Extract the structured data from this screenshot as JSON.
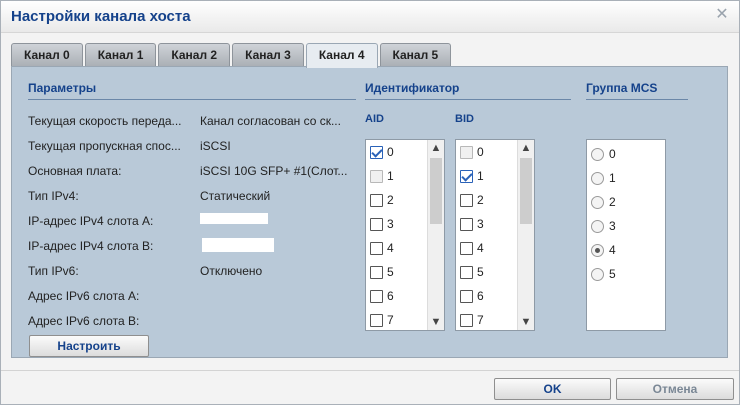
{
  "dialog": {
    "title": "Настройки канала хоста"
  },
  "tabs": [
    {
      "label": "Канал 0",
      "active": false
    },
    {
      "label": "Канал 1",
      "active": false
    },
    {
      "label": "Канал 2",
      "active": false
    },
    {
      "label": "Канал 3",
      "active": false
    },
    {
      "label": "Канал 4",
      "active": true
    },
    {
      "label": "Канал 5",
      "active": false
    }
  ],
  "params": {
    "title": "Параметры",
    "rows": [
      {
        "label": "Текущая скорость переда...",
        "value": "Канал согласован со ск..."
      },
      {
        "label": "Текущая пропускная спос...",
        "value": "iSCSI"
      },
      {
        "label": "Основная плата:",
        "value": "iSCSI 10G SFP+ #1(Слот..."
      },
      {
        "label": "Тип IPv4:",
        "value": "Статический"
      },
      {
        "label": "IP-адрес IPv4 слота A:",
        "value": ""
      },
      {
        "label": "IP-адрес IPv4 слота B:",
        "value": ""
      },
      {
        "label": "Тип IPv6:",
        "value": "Отключено"
      },
      {
        "label": "Адрес IPv6 слота A:",
        "value": ""
      },
      {
        "label": "Адрес IPv6 слота B:",
        "value": ""
      }
    ],
    "configure_button": "Настроить"
  },
  "identifier": {
    "title": "Идентификатор",
    "aid_label": "AID",
    "bid_label": "BID",
    "aid_items": [
      {
        "label": "0",
        "checked": true,
        "disabled": false
      },
      {
        "label": "1",
        "checked": false,
        "disabled": true
      },
      {
        "label": "2",
        "checked": false,
        "disabled": false
      },
      {
        "label": "3",
        "checked": false,
        "disabled": false
      },
      {
        "label": "4",
        "checked": false,
        "disabled": false
      },
      {
        "label": "5",
        "checked": false,
        "disabled": false
      },
      {
        "label": "6",
        "checked": false,
        "disabled": false
      },
      {
        "label": "7",
        "checked": false,
        "disabled": false
      }
    ],
    "bid_items": [
      {
        "label": "0",
        "checked": false,
        "disabled": true
      },
      {
        "label": "1",
        "checked": true,
        "disabled": false
      },
      {
        "label": "2",
        "checked": false,
        "disabled": false
      },
      {
        "label": "3",
        "checked": false,
        "disabled": false
      },
      {
        "label": "4",
        "checked": false,
        "disabled": false
      },
      {
        "label": "5",
        "checked": false,
        "disabled": false
      },
      {
        "label": "6",
        "checked": false,
        "disabled": false
      },
      {
        "label": "7",
        "checked": false,
        "disabled": false
      }
    ]
  },
  "mcs": {
    "title": "Группа MCS",
    "options": [
      "0",
      "1",
      "2",
      "3",
      "4",
      "5"
    ],
    "selected": "4"
  },
  "footer": {
    "ok_label": "OK",
    "cancel_label": "Отмена"
  },
  "icons": {
    "close": "close-icon",
    "scroll_up": "chevron-up-icon",
    "scroll_down": "chevron-down-icon"
  },
  "colors": {
    "accent": "#15428b",
    "panel": "#b9c9d8",
    "checkbox_checked": "#2a62b8"
  }
}
